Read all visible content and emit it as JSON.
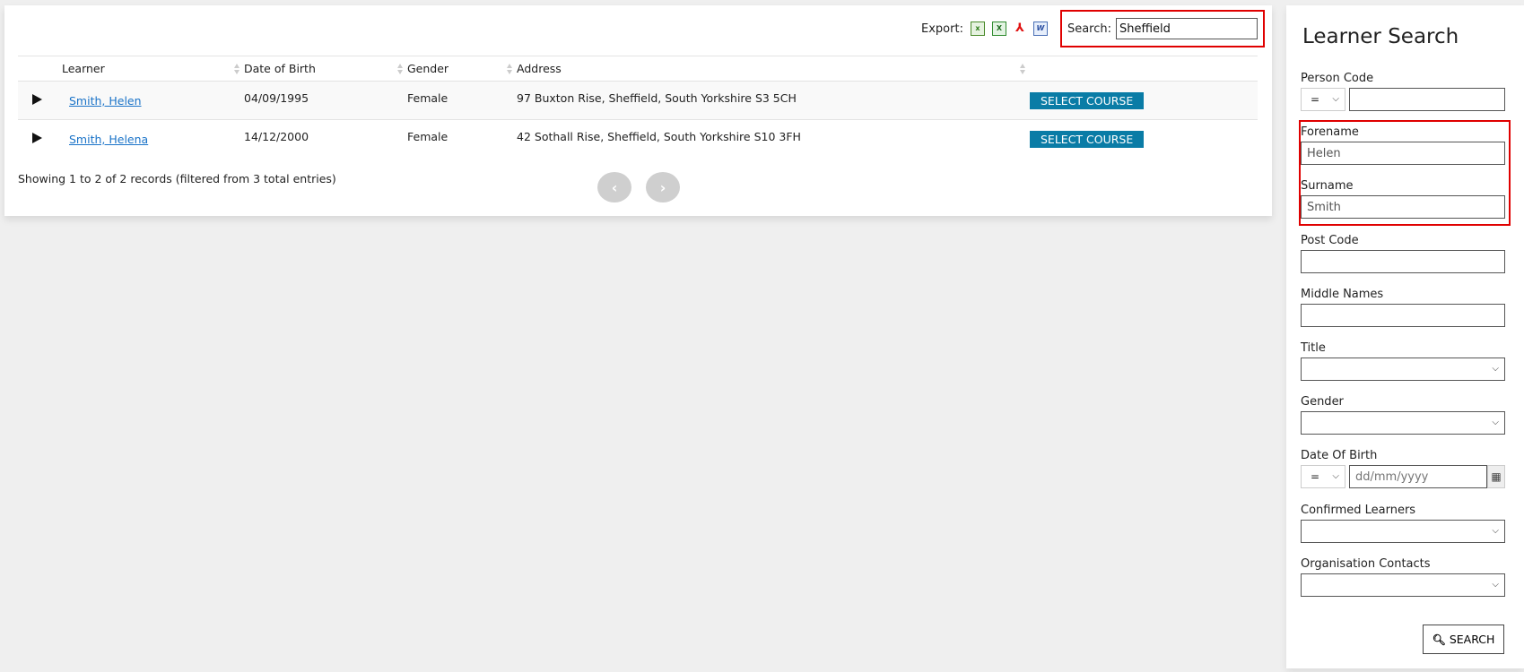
{
  "toolbar": {
    "export_label": "Export:",
    "export_icons": [
      "csv-icon",
      "excel-icon",
      "pdf-icon",
      "word-icon"
    ],
    "search_label": "Search:",
    "search_value": "Sheffield"
  },
  "table": {
    "columns": [
      "",
      "Learner",
      "Date of Birth",
      "Gender",
      "Address",
      ""
    ],
    "rows": [
      {
        "learner": "Smith, Helen",
        "dob": "04/09/1995",
        "gender": "Female",
        "address": "97 Buxton Rise, Sheffield, South Yorkshire S3 5CH",
        "action": "SELECT COURSE"
      },
      {
        "learner": "Smith, Helena",
        "dob": "14/12/2000",
        "gender": "Female",
        "address": "42 Sothall Rise, Sheffield, South Yorkshire S10 3FH",
        "action": "SELECT COURSE"
      }
    ],
    "info": "Showing 1 to 2 of 2 records (filtered from 3 total entries)",
    "pager": {
      "prev": "‹",
      "next": "›"
    }
  },
  "side": {
    "title": "Learner Search",
    "person_code": {
      "label": "Person Code",
      "operator": "=",
      "value": ""
    },
    "forename": {
      "label": "Forename",
      "value": "Helen"
    },
    "surname": {
      "label": "Surname",
      "value": "Smith"
    },
    "post_code": {
      "label": "Post Code",
      "value": ""
    },
    "middle_names": {
      "label": "Middle Names",
      "value": ""
    },
    "title_field": {
      "label": "Title",
      "value": ""
    },
    "gender": {
      "label": "Gender",
      "value": ""
    },
    "dob": {
      "label": "Date Of Birth",
      "operator": "=",
      "placeholder": "dd/mm/yyyy"
    },
    "confirmed": {
      "label": "Confirmed Learners",
      "value": ""
    },
    "org_contacts": {
      "label": "Organisation Contacts",
      "value": ""
    },
    "search_button": "SEARCH"
  },
  "colors": {
    "accent": "#0a7ca6",
    "link": "#1a73c8",
    "highlight": "#e00000"
  }
}
